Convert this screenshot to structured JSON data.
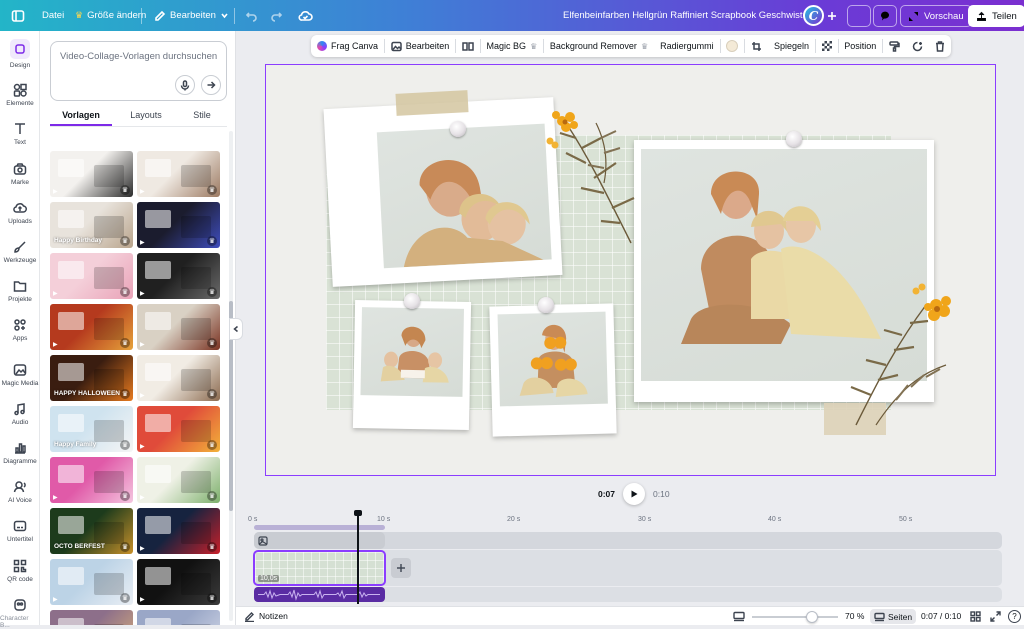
{
  "topbar": {
    "file": "Datei",
    "resize": "Größe ändern",
    "edit": "Bearbeiten",
    "title": "Elfenbeinfarben Hellgrün Raffiniert Scrapbook Geschwister...",
    "preview": "Vorschau",
    "share": "Teilen",
    "avatar_letter": "C"
  },
  "rail": {
    "items": [
      {
        "label": "Design"
      },
      {
        "label": "Elemente"
      },
      {
        "label": "Text"
      },
      {
        "label": "Marke"
      },
      {
        "label": "Uploads"
      },
      {
        "label": "Werkzeuge"
      },
      {
        "label": "Projekte"
      },
      {
        "label": "Apps"
      },
      {
        "label": "Magic Media"
      },
      {
        "label": "Audio"
      },
      {
        "label": "Diagramme"
      },
      {
        "label": "AI Voice"
      },
      {
        "label": "Untertitel"
      },
      {
        "label": "QR code"
      },
      {
        "label": "Character B..."
      }
    ]
  },
  "panel": {
    "search_placeholder": "Video-Collage-Vorlagen durchsuchen",
    "tabs": [
      "Vorlagen",
      "Layouts",
      "Stile"
    ],
    "thumbs": [
      {
        "label": "",
        "c1": "#f3f1ee",
        "c2": "#2b2b2b"
      },
      {
        "label": "",
        "c1": "#efe9e2",
        "c2": "#9c7a62"
      },
      {
        "label": "Happy Birthday",
        "c1": "#e8e3dc",
        "c2": "#b9a48c"
      },
      {
        "label": "",
        "c1": "#1b1c2e",
        "c2": "#3f4dbd"
      },
      {
        "label": "",
        "c1": "#f4cfd9",
        "c2": "#e9a3b8"
      },
      {
        "label": "",
        "c1": "#202020",
        "c2": "#6a6a6a"
      },
      {
        "label": "",
        "c1": "#b53a1e",
        "c2": "#e6a23a"
      },
      {
        "label": "",
        "c1": "#d9d1c4",
        "c2": "#7a3322"
      },
      {
        "label": "HAPPY HALLOWEEN",
        "c1": "#3a1d10",
        "c2": "#e77a1e"
      },
      {
        "label": "",
        "c1": "#f1ece4",
        "c2": "#8c6b50"
      },
      {
        "label": "Happy Family",
        "c1": "#cfe3ef",
        "c2": "#f5f5f5"
      },
      {
        "label": "",
        "c1": "#e04b3a",
        "c2": "#f2b23a"
      },
      {
        "label": "",
        "c1": "#e05aa8",
        "c2": "#f4c6df"
      },
      {
        "label": "",
        "c1": "#eff1e6",
        "c2": "#7db06c"
      },
      {
        "label": "OCTO BERFEST",
        "c1": "#1d3b1c",
        "c2": "#c7902a"
      },
      {
        "label": "",
        "c1": "#16233f",
        "c2": "#c8202a"
      },
      {
        "label": "",
        "c1": "#bcd3e6",
        "c2": "#e9eef4"
      },
      {
        "label": "",
        "c1": "#111111",
        "c2": "#3b3b3b"
      },
      {
        "label": "",
        "c1": "#8d6f8a",
        "c2": "#d9b07a"
      },
      {
        "label": "",
        "c1": "#9aa7c7",
        "c2": "#d6dbe9"
      }
    ]
  },
  "context_toolbar": {
    "ask_canva": "Frag Canva",
    "edit": "Bearbeiten",
    "magic_bg": "Magic BG",
    "bg_remover": "Background Remover",
    "eraser": "Radiergummi",
    "flip": "Spiegeln",
    "position": "Position"
  },
  "playback": {
    "current": "0:07",
    "total": "0:10"
  },
  "timeline": {
    "ticks": [
      "0 s",
      "10 s",
      "20 s",
      "30 s",
      "40 s",
      "50 s"
    ],
    "clip_label": "10,0s",
    "playhead_position": 0.7
  },
  "bottom": {
    "notes": "Notizen",
    "zoom": "70 %",
    "zoom_level": 0.7,
    "pages": "Seiten",
    "time": "0:07 / 0:10"
  },
  "colors": {
    "accent": "#8b3dff",
    "collage_green": "#d9e2d5",
    "flower_orange": "#f0a51a"
  }
}
